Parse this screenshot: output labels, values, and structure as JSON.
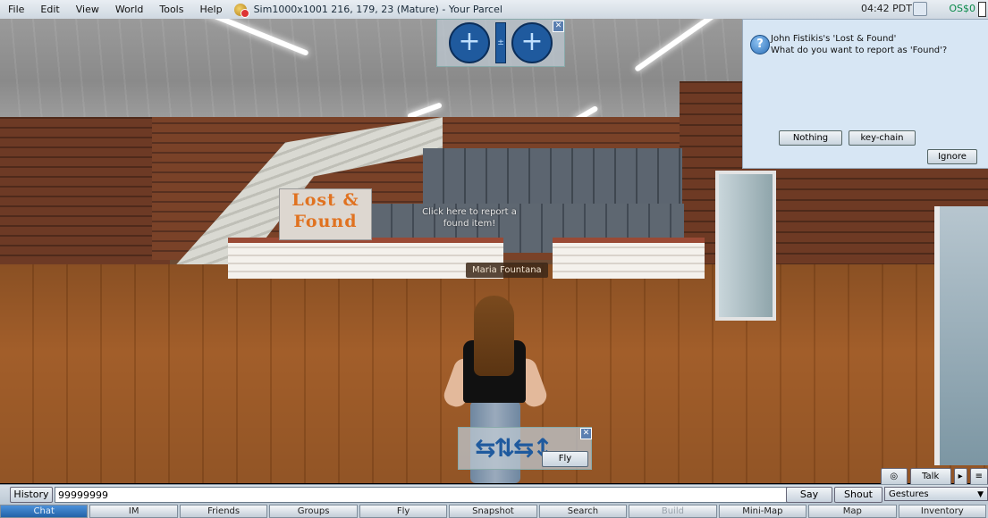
{
  "menubar": {
    "items": [
      "File",
      "Edit",
      "View",
      "World",
      "Tools",
      "Help"
    ],
    "location": "Sim1000x1001 216, 179, 23 (Mature) - Your Parcel",
    "clock": "04:42 PDT",
    "balance": "OS$0"
  },
  "scene": {
    "sign_text": "Lost & Found",
    "hint": "Click here to report a found item!",
    "avatar_name": "Maria Fountana"
  },
  "camera_controls": {
    "close": "✕"
  },
  "movement_controls": {
    "fly_label": "Fly",
    "close": "✕"
  },
  "dialog": {
    "title": "John Fistikis's 'Lost & Found'",
    "question": "What do you want to report as 'Found'?",
    "buttons": {
      "nothing": "Nothing",
      "keychain": "key-chain",
      "ignore": "Ignore"
    }
  },
  "voice": {
    "talk_label": "Talk"
  },
  "chatbar": {
    "history_label": "History",
    "input_value": "99999999",
    "say_label": "Say",
    "shout_label": "Shout",
    "gestures_label": "Gestures"
  },
  "tabs": [
    {
      "label": "Chat",
      "state": "active"
    },
    {
      "label": "IM",
      "state": "normal"
    },
    {
      "label": "Friends",
      "state": "normal"
    },
    {
      "label": "Groups",
      "state": "normal"
    },
    {
      "label": "Fly",
      "state": "normal"
    },
    {
      "label": "Snapshot",
      "state": "normal"
    },
    {
      "label": "Search",
      "state": "normal"
    },
    {
      "label": "Build",
      "state": "disabled"
    },
    {
      "label": "Mini-Map",
      "state": "normal"
    },
    {
      "label": "Map",
      "state": "normal"
    },
    {
      "label": "Inventory",
      "state": "normal"
    }
  ]
}
